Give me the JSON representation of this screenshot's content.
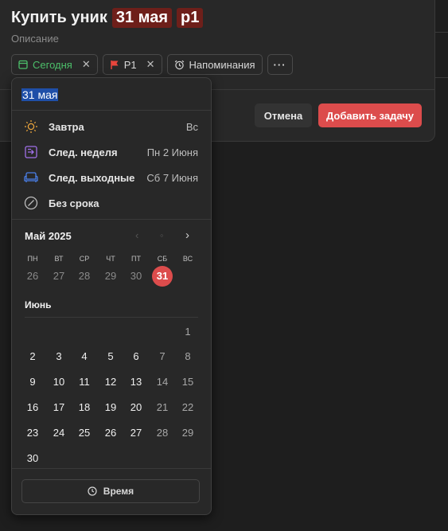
{
  "task": {
    "title_text": "Купить уник",
    "title_date_token": "31 мая",
    "title_priority_token": "p1",
    "description_placeholder": "Описание"
  },
  "chips": {
    "today_label": "Сегодня",
    "priority_label": "P1",
    "reminders_label": "Напоминания",
    "more_label": "···"
  },
  "actions": {
    "cancel_label": "Отмена",
    "add_label": "Добавить задачу"
  },
  "date_picker": {
    "input_value": "31 мая",
    "quick_options": [
      {
        "label": "Завтра",
        "meta": "Вс",
        "icon": "sun-icon",
        "color": "#e8a33d"
      },
      {
        "label": "След. неделя",
        "meta": "Пн 2 Июня",
        "icon": "next-week-icon",
        "color": "#a070e8"
      },
      {
        "label": "След. выходные",
        "meta": "Сб 7 Июня",
        "icon": "sofa-icon",
        "color": "#4a7fe8"
      },
      {
        "label": "Без срока",
        "meta": "",
        "icon": "no-date-icon",
        "color": "#bdbdbd"
      }
    ],
    "month1": {
      "label": "Май 2025",
      "days": [
        "26",
        "27",
        "28",
        "29",
        "30",
        "31"
      ],
      "selected": "31"
    },
    "weekdays": [
      "ПН",
      "ВТ",
      "СР",
      "ЧТ",
      "ПТ",
      "СБ",
      "ВС"
    ],
    "month2": {
      "label": "Июнь",
      "weeks": [
        [
          "",
          "",
          "",
          "",
          "",
          "",
          "1"
        ],
        [
          "2",
          "3",
          "4",
          "5",
          "6",
          "7",
          "8"
        ],
        [
          "9",
          "10",
          "11",
          "12",
          "13",
          "14",
          "15"
        ],
        [
          "16",
          "17",
          "18",
          "19",
          "20",
          "21",
          "22"
        ],
        [
          "23",
          "24",
          "25",
          "26",
          "27",
          "28",
          "29"
        ],
        [
          "30",
          "",
          "",
          "",
          "",
          "",
          ""
        ]
      ]
    },
    "time_label": "Время"
  },
  "colors": {
    "accent": "#dc4c4c",
    "today_green": "#4cbf6a",
    "priority_red": "#e8453c"
  }
}
